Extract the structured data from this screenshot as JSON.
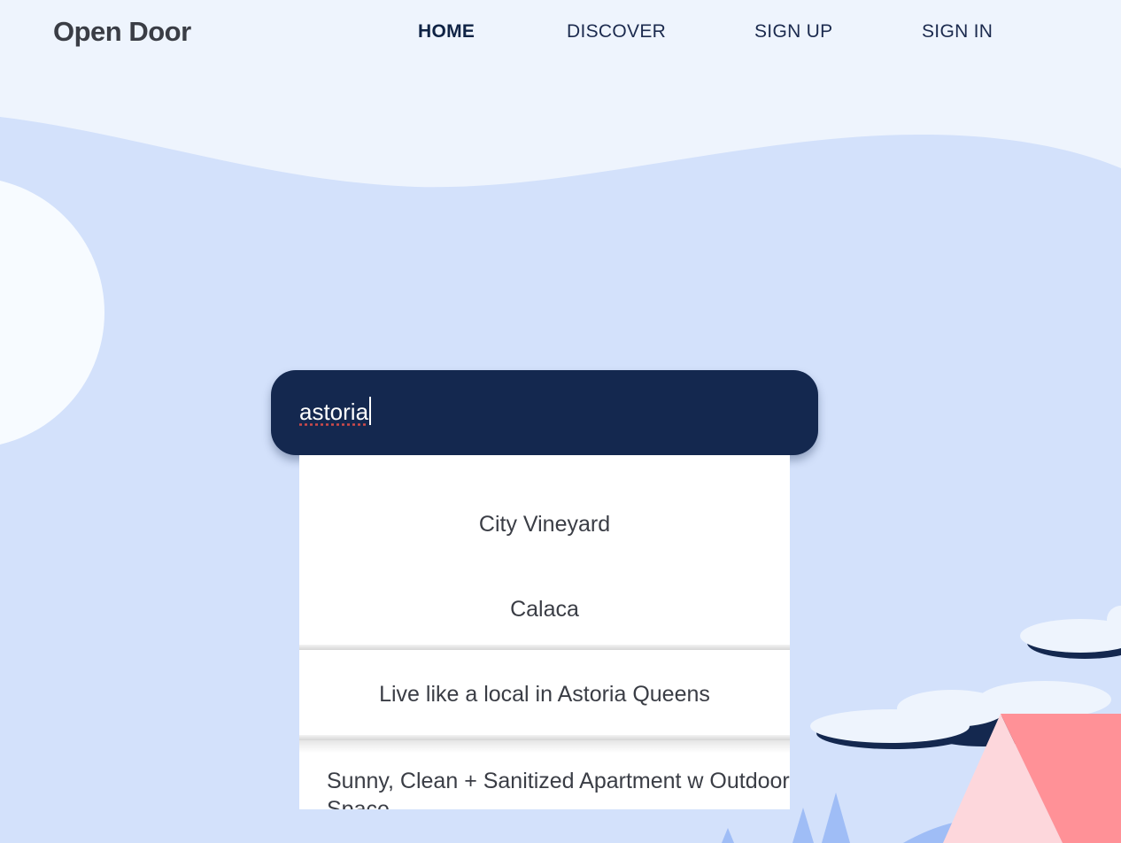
{
  "app": {
    "logo": "Open Door"
  },
  "nav": {
    "items": [
      {
        "label": "HOME",
        "active": true
      },
      {
        "label": "DISCOVER",
        "active": false
      },
      {
        "label": "SIGN UP",
        "active": false
      },
      {
        "label": "SIGN IN",
        "active": false
      }
    ]
  },
  "search": {
    "value": "astoria"
  },
  "results": [
    "City Vineyard",
    "Calaca",
    "Live like a local in Astoria Queens",
    "Sunny, Clean + Sanitized Apartment w Outdoor Space"
  ],
  "colors": {
    "page_bg": "#eef4fd",
    "sky": "#d3e1fb",
    "search_bg": "#14284f",
    "tent_pink": "#ff9197",
    "tent_light": "#fdd7dc",
    "cloud": "#eef4fd",
    "cloud_shadow": "#14284f"
  }
}
